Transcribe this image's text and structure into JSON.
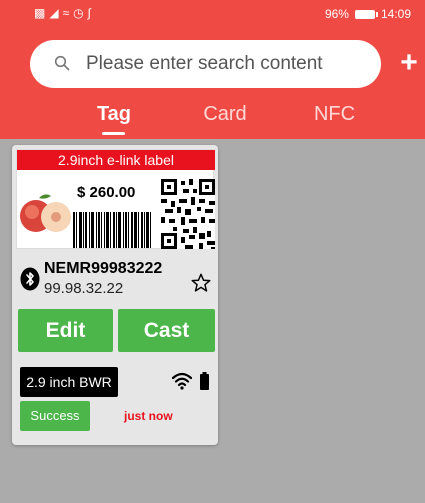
{
  "status_bar": {
    "left_icons": [
      "message-icon",
      "signal-icon",
      "wifi-icon",
      "alarm-icon",
      "bluetooth-icon"
    ],
    "battery_percent": "96%",
    "time": "14:09"
  },
  "search": {
    "placeholder": "Please enter search content"
  },
  "tabs": [
    {
      "label": "Tag",
      "active": true
    },
    {
      "label": "Card",
      "active": false
    },
    {
      "label": "NFC",
      "active": false
    }
  ],
  "device_card": {
    "label_preview": {
      "header": "2.9inch e-link label",
      "price": "$ 260.00"
    },
    "device_name": "NEMR99983222",
    "device_ip": "99.98.32.22",
    "edit_label": "Edit",
    "cast_label": "Cast",
    "type": "2.9 inch BWR",
    "status": "Success",
    "time": "just now"
  },
  "colors": {
    "header": "#f04a45",
    "button_green": "#4cb64a",
    "label_red": "#e8121f",
    "background": "#ababab"
  }
}
